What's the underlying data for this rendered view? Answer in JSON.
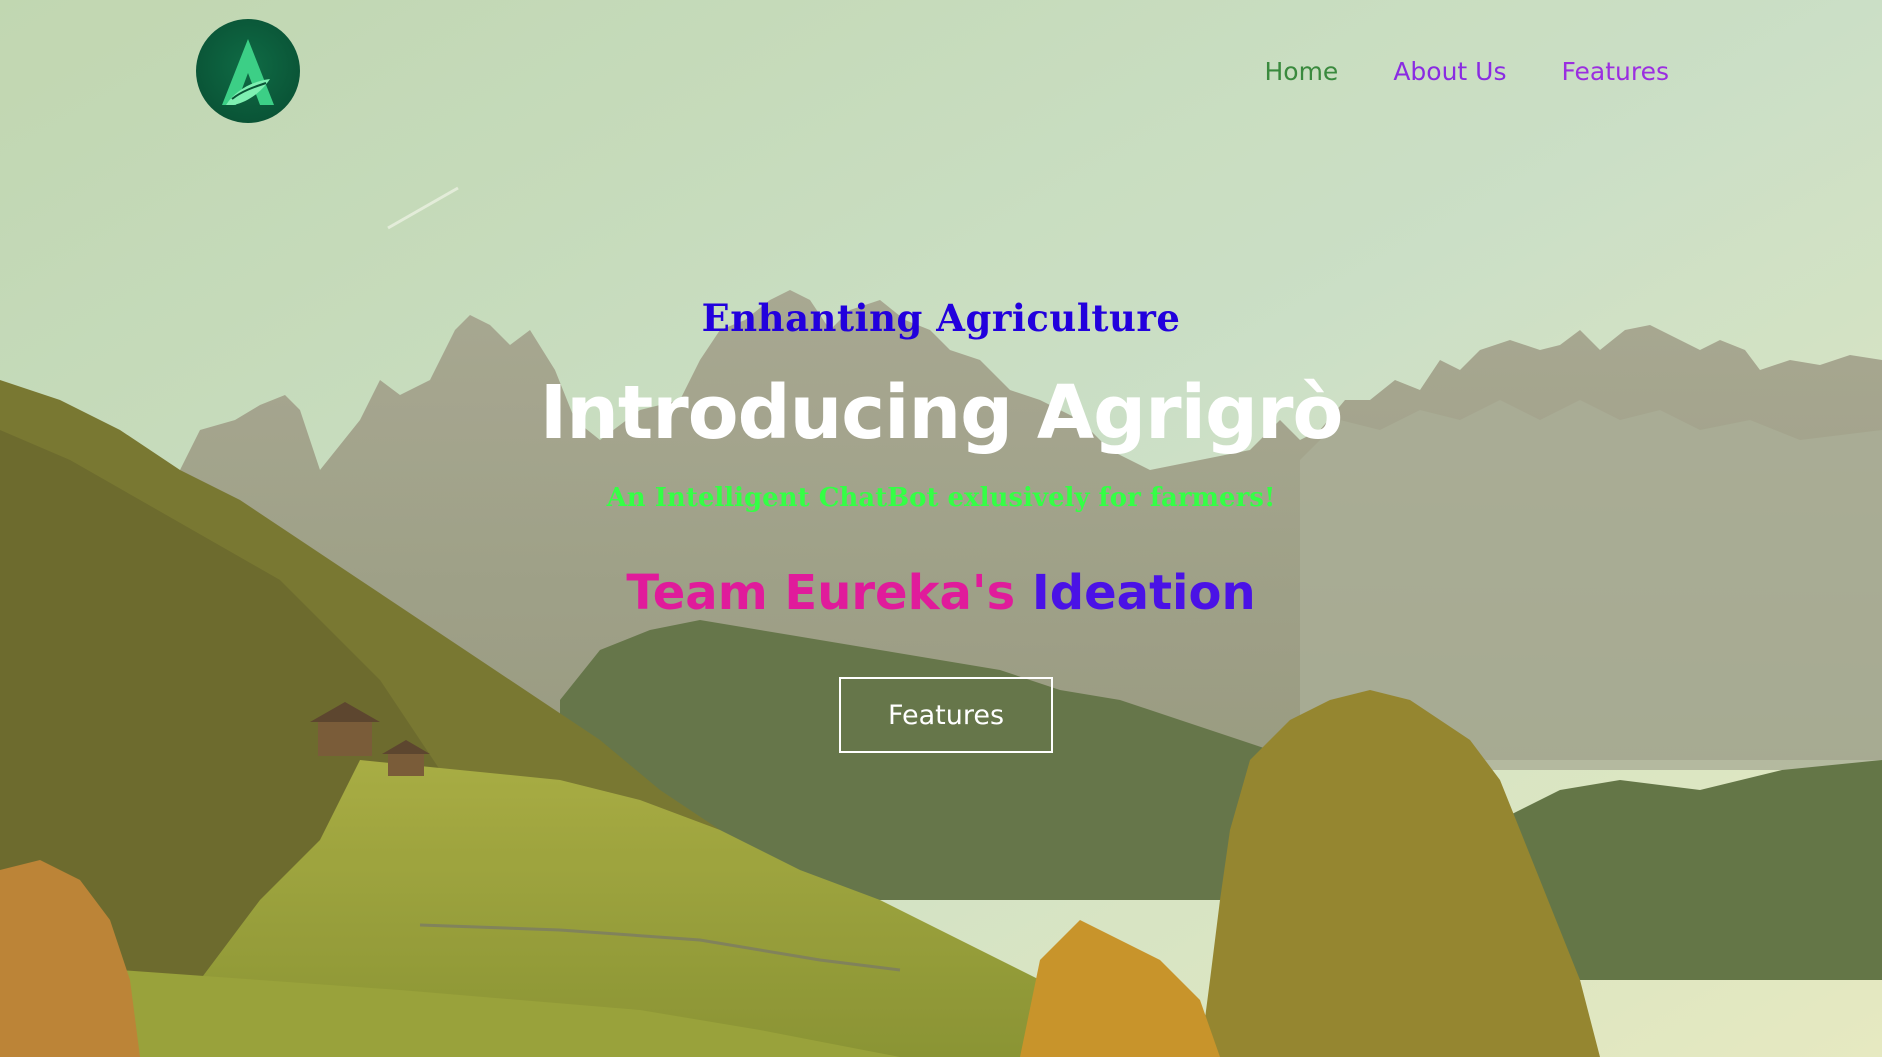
{
  "brand": {
    "logo_icon": "agrigro-leaf-mountain-logo",
    "logo_colors": [
      "#0a5537",
      "#3ccf86"
    ]
  },
  "nav": {
    "home": "Home",
    "about": "About Us",
    "features": "Features"
  },
  "hero": {
    "eyebrow": "Enhanting Agriculture",
    "headline": "Introducing Agrigrò",
    "tagline": "An Intelligent ChatBot exlusively for farmers!",
    "team_name": "Team Eureka's",
    "team_ideation": "Ideation",
    "cta_label": "Features"
  },
  "colors": {
    "eyebrow": "#2200dd",
    "headline": "#ffffff",
    "tagline": "#34ff45",
    "team_name": "#e01b9b",
    "team_ideation": "#4a12e6",
    "nav_home": "#3a8a3e",
    "nav_links": "#8a2be2"
  }
}
